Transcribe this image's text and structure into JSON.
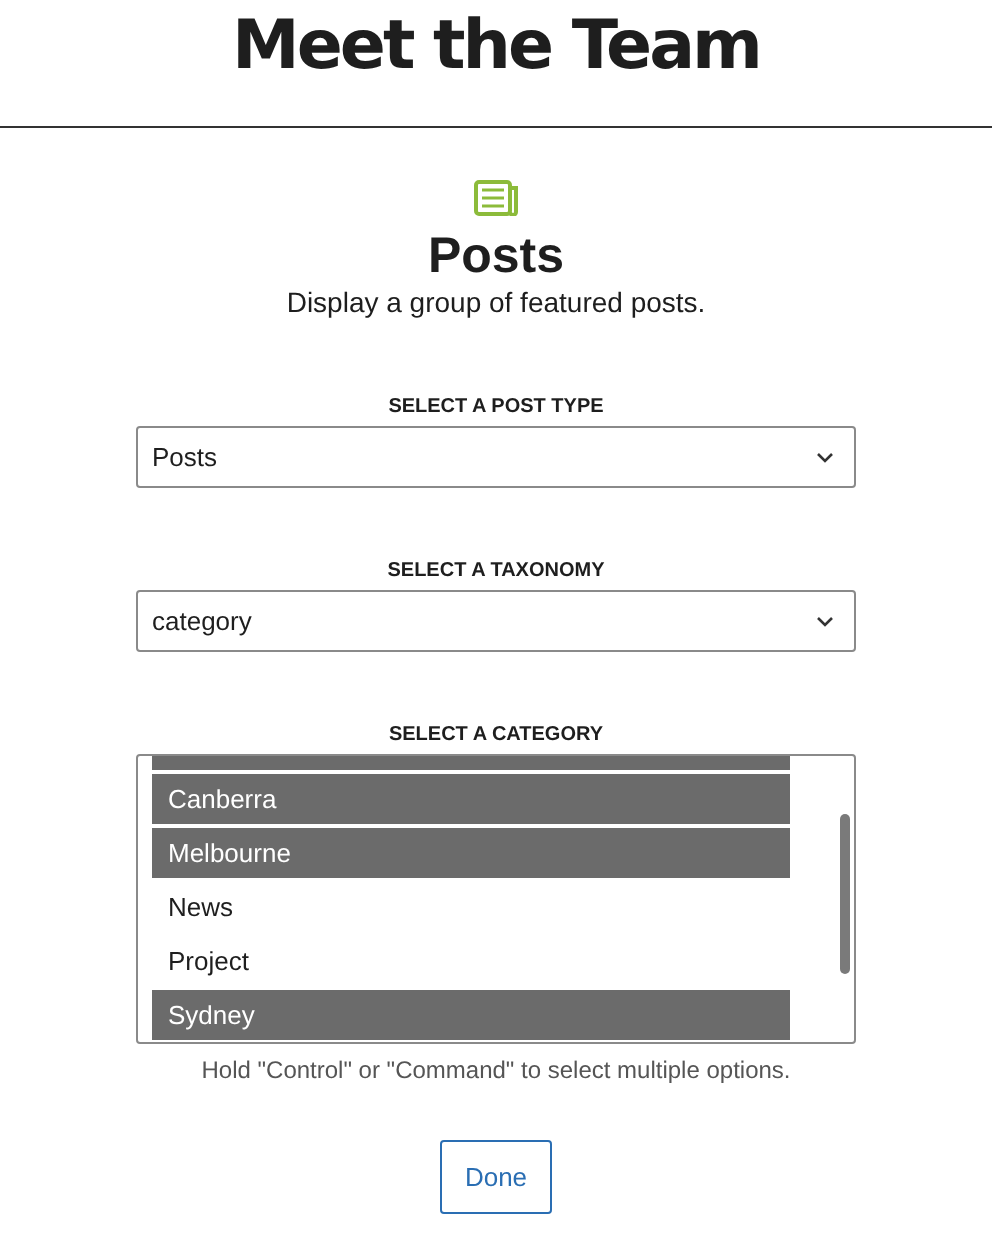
{
  "page_title": "Meet the Team",
  "block": {
    "title": "Posts",
    "description": "Display a group of featured posts."
  },
  "post_type": {
    "label": "SELECT A POST TYPE",
    "value": "Posts"
  },
  "taxonomy": {
    "label": "SELECT A TAXONOMY",
    "value": "category"
  },
  "category": {
    "label": "SELECT A CATEGORY",
    "options": [
      {
        "selected": true
      },
      {
        "label": "Canberra",
        "selected": true
      },
      {
        "label": "Melbourne",
        "selected": true
      },
      {
        "label": "News",
        "selected": false
      },
      {
        "label": "Project",
        "selected": false
      },
      {
        "label": "Sydney",
        "selected": true
      }
    ],
    "help": "Hold \"Control\" or \"Command\" to select multiple options."
  },
  "done_button": "Done"
}
